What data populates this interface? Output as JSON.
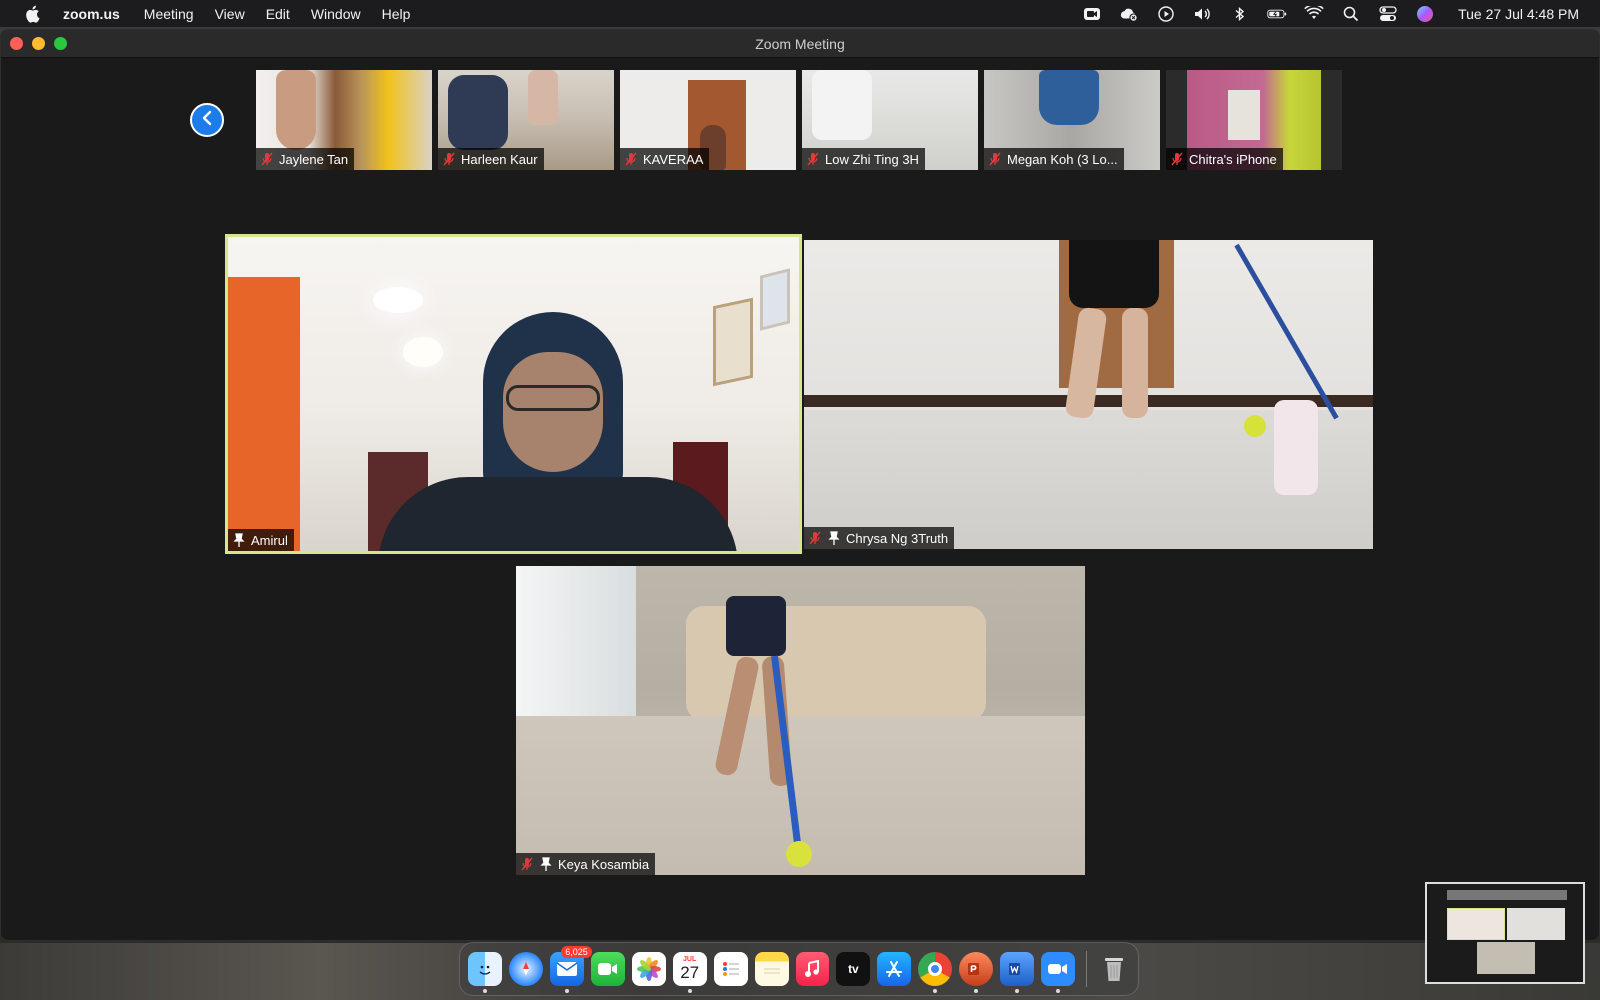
{
  "menubar": {
    "app_name": "zoom.us",
    "menus": [
      "Meeting",
      "View",
      "Edit",
      "Window",
      "Help"
    ],
    "clock": "Tue 27 Jul  4:48 PM",
    "status_icons": [
      "zoom-icon",
      "cloud-icon",
      "play-icon",
      "volume-icon",
      "bluetooth-icon",
      "battery-icon",
      "wifi-icon",
      "search-icon",
      "control-center-icon",
      "siri-icon"
    ]
  },
  "window": {
    "title": "Zoom Meeting"
  },
  "thumbnails": [
    {
      "name": "Jaylene Tan",
      "muted": true,
      "scene": "#8b7a66"
    },
    {
      "name": "Harleen Kaur",
      "muted": true,
      "scene": "#a6a39d"
    },
    {
      "name": "KAVERAA",
      "muted": true,
      "scene": "#d8d4cf"
    },
    {
      "name": "Low Zhi Ting 3H",
      "muted": true,
      "scene": "#c9c9c6"
    },
    {
      "name": "Megan Koh (3 Lo...",
      "muted": true,
      "scene": "#9a9894"
    },
    {
      "name": "Chitra's iPhone",
      "muted": true,
      "scene": "#b85f84"
    }
  ],
  "tiles": [
    {
      "name": "Amirul",
      "muted": false,
      "pinned": true,
      "active": true
    },
    {
      "name": "Chrysa Ng 3Truth",
      "muted": true,
      "pinned": true,
      "active": false
    },
    {
      "name": "Keya Kosambia",
      "muted": true,
      "pinned": true,
      "active": false
    }
  ],
  "dock": {
    "mail_badge": "6,025",
    "calendar_month": "JUL",
    "calendar_day": "27",
    "apps": [
      "finder-icon",
      "safari-icon",
      "mail-icon",
      "facetime-icon",
      "photos-icon",
      "calendar-icon",
      "reminders-icon",
      "notes-icon",
      "music-icon",
      "apple-tv-icon",
      "app-store-icon",
      "chrome-icon",
      "powerpoint-icon",
      "word-icon",
      "zoom-icon",
      "trash-icon"
    ],
    "tv_label": "tv"
  }
}
